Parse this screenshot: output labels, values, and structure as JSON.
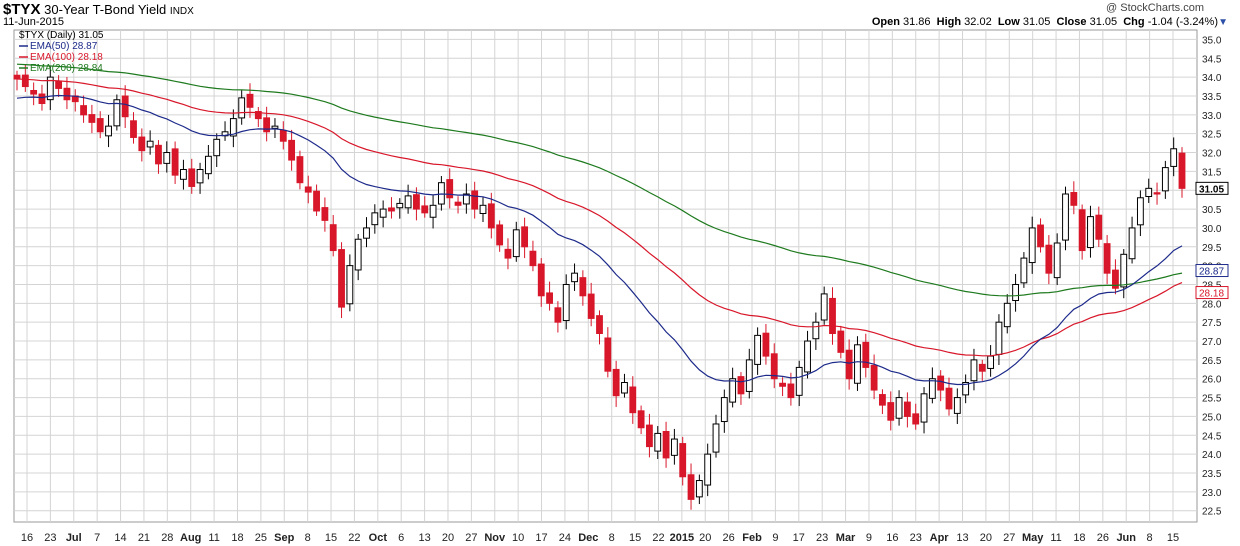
{
  "header": {
    "symbol": "$TYX",
    "description": "30-Year T-Bond Yield",
    "exchange": "INDX",
    "date": "11-Jun-2015",
    "watermark": "@ StockCharts.com",
    "open_label": "Open",
    "open": "31.86",
    "high_label": "High",
    "high": "32.02",
    "low_label": "Low",
    "low": "31.05",
    "close_label": "Close",
    "close": "31.05",
    "chg_label": "Chg",
    "chg": "-1.04 (-3.24%)"
  },
  "colors": {
    "up": "#000000",
    "down": "#d8172a",
    "ema50": "#1d2a8a",
    "ema100": "#d8172a",
    "ema200": "#1e7a1e",
    "grid": "#d4d4d4"
  },
  "chart_data": {
    "type": "candlestick",
    "ylim": [
      22.2,
      35.25
    ],
    "yticks": [
      "35.0",
      "34.5",
      "34.0",
      "33.5",
      "33.0",
      "32.5",
      "32.0",
      "31.5",
      "31.0",
      "30.5",
      "30.0",
      "29.5",
      "29.0",
      "28.5",
      "28.0",
      "27.5",
      "27.0",
      "26.5",
      "26.0",
      "25.5",
      "25.0",
      "24.5",
      "24.0",
      "23.5",
      "23.0",
      "22.5"
    ],
    "xtick_labels": [
      "16",
      "23",
      "Jul",
      "7",
      "14",
      "21",
      "28",
      "Aug",
      "11",
      "18",
      "25",
      "Sep",
      "8",
      "15",
      "22",
      "Oct",
      "6",
      "13",
      "20",
      "27",
      "Nov",
      "10",
      "17",
      "24",
      "Dec",
      "8",
      "15",
      "22",
      "2015",
      "20",
      "26",
      "Feb",
      "9",
      "17",
      "23",
      "Mar",
      "9",
      "16",
      "23",
      "Apr",
      "13",
      "20",
      "27",
      "May",
      "11",
      "18",
      "26",
      "Jun",
      "8",
      "15"
    ],
    "xtick_bold": [
      "Jul",
      "Aug",
      "Sep",
      "Oct",
      "Nov",
      "Dec",
      "2015",
      "Feb",
      "Mar",
      "Apr",
      "May",
      "Jun"
    ],
    "legend": [
      {
        "name": "$TYX (Daily)",
        "value": "31.05",
        "color": "#000000"
      },
      {
        "name": "EMA(50)",
        "value": "28.87",
        "color": "#1d2a8a"
      },
      {
        "name": "EMA(100)",
        "value": "28.18",
        "color": "#d8172a"
      },
      {
        "name": "EMA(200)",
        "value": "28.84",
        "color": "#1e7a1e"
      }
    ],
    "last_value_tags": [
      {
        "value": "31.05",
        "color": "#000000",
        "bold": true
      },
      {
        "value": "28.87",
        "color": "#1d2a8a",
        "bold": false
      },
      {
        "value": "28.18",
        "color": "#d8172a",
        "bold": false
      }
    ],
    "closes": [
      33.95,
      33.75,
      33.55,
      33.3,
      34.0,
      33.7,
      33.4,
      33.35,
      33.0,
      32.8,
      32.55,
      32.7,
      33.4,
      32.95,
      32.4,
      32.05,
      32.3,
      31.7,
      32.0,
      31.4,
      31.55,
      31.1,
      31.55,
      31.9,
      32.35,
      32.55,
      32.9,
      33.45,
      33.2,
      32.9,
      32.55,
      32.7,
      32.3,
      31.8,
      31.2,
      30.95,
      30.45,
      30.2,
      29.4,
      27.9,
      29.0,
      29.7,
      30.0,
      30.4,
      30.5,
      30.45,
      30.65,
      30.85,
      30.5,
      30.4,
      30.6,
      31.2,
      30.8,
      30.6,
      30.9,
      30.5,
      30.6,
      30.0,
      29.55,
      29.2,
      29.95,
      29.5,
      29.0,
      28.2,
      28.0,
      27.5,
      28.5,
      28.8,
      28.2,
      27.6,
      27.2,
      26.2,
      25.55,
      25.9,
      25.1,
      24.7,
      24.2,
      24.55,
      23.9,
      24.4,
      23.4,
      22.8,
      23.3,
      24.0,
      24.8,
      25.5,
      26.0,
      25.6,
      26.5,
      27.15,
      26.6,
      26.0,
      25.8,
      25.5,
      26.3,
      27.0,
      27.5,
      28.25,
      27.2,
      26.7,
      26.0,
      26.9,
      26.3,
      25.7,
      25.3,
      24.9,
      25.5,
      25.0,
      24.8,
      25.6,
      26.0,
      25.7,
      25.2,
      25.5,
      25.9,
      26.5,
      26.2,
      26.6,
      27.5,
      28.0,
      28.5,
      29.2,
      30.0,
      29.5,
      28.8,
      29.6,
      30.9,
      30.6,
      29.4,
      30.3,
      29.7,
      28.8,
      28.4,
      29.3,
      30.0,
      30.8,
      31.05,
      30.9,
      31.6,
      32.1,
      31.05
    ]
  }
}
